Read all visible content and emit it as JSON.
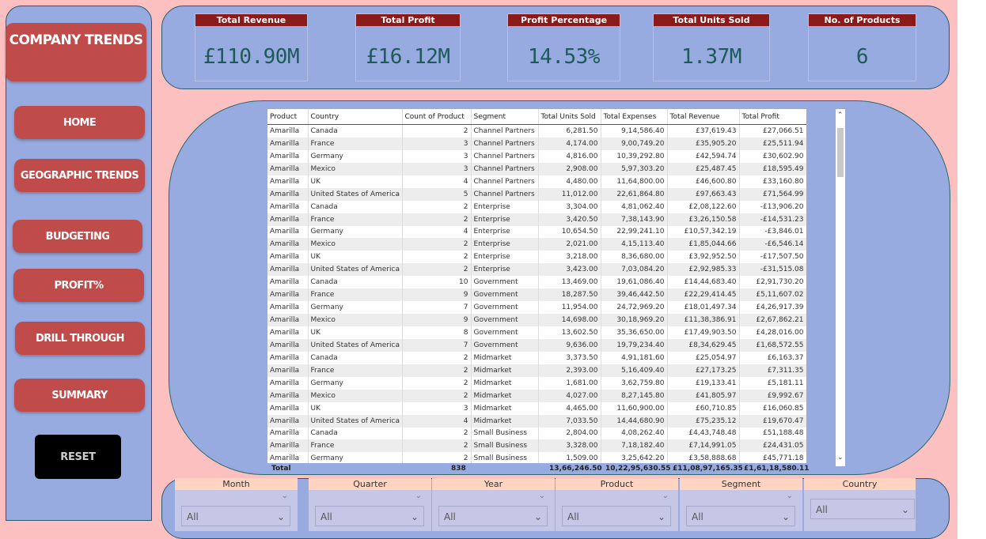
{
  "sidebar": {
    "logo": "COMPANY TRENDS",
    "nav": [
      "HOME",
      "GEOGRAPHIC TRENDS",
      "BUDGETING",
      "PROFIT%",
      "DRILL THROUGH",
      "SUMMARY"
    ],
    "reset": "RESET"
  },
  "kpis": [
    {
      "title": "Total Revenue",
      "value": "£110.90M"
    },
    {
      "title": "Total Profit",
      "value": "£16.12M"
    },
    {
      "title": "Profit Percentage",
      "value": "14.53%"
    },
    {
      "title": "Total Units Sold",
      "value": "1.37M"
    },
    {
      "title": "No. of Products",
      "value": "6"
    }
  ],
  "table": {
    "headers": [
      "Product",
      "Country",
      "Count of Product",
      "Segment",
      "Total Units Sold",
      "Total Expenses",
      "Total Revenue",
      "Total Profit"
    ],
    "rows": [
      [
        "Amarilla",
        "Canada",
        "2",
        "Channel Partners",
        "6,281.50",
        "9,14,586.40",
        "£37,619.43",
        "£27,066.51"
      ],
      [
        "Amarilla",
        "France",
        "3",
        "Channel Partners",
        "4,174.00",
        "9,00,749.20",
        "£35,905.20",
        "£25,511.94"
      ],
      [
        "Amarilla",
        "Germany",
        "3",
        "Channel Partners",
        "4,816.00",
        "10,39,292.80",
        "£42,594.74",
        "£30,602.90"
      ],
      [
        "Amarilla",
        "Mexico",
        "3",
        "Channel Partners",
        "2,908.00",
        "5,97,303.20",
        "£25,487.45",
        "£18,595.49"
      ],
      [
        "Amarilla",
        "UK",
        "4",
        "Channel Partners",
        "4,480.00",
        "11,64,800.00",
        "£46,600.80",
        "£33,160.80"
      ],
      [
        "Amarilla",
        "United States of America",
        "5",
        "Channel Partners",
        "11,012.00",
        "22,61,864.80",
        "£97,663.43",
        "£71,564.99"
      ],
      [
        "Amarilla",
        "Canada",
        "2",
        "Enterprise",
        "3,304.00",
        "4,81,062.40",
        "£2,08,122.60",
        "-£13,906.20"
      ],
      [
        "Amarilla",
        "France",
        "2",
        "Enterprise",
        "3,420.50",
        "7,38,143.90",
        "£3,26,150.58",
        "-£14,531.23"
      ],
      [
        "Amarilla",
        "Germany",
        "4",
        "Enterprise",
        "10,654.50",
        "22,99,241.10",
        "£10,57,342.19",
        "-£3,846.01"
      ],
      [
        "Amarilla",
        "Mexico",
        "2",
        "Enterprise",
        "2,021.00",
        "4,15,113.40",
        "£1,85,044.66",
        "-£6,546.14"
      ],
      [
        "Amarilla",
        "UK",
        "2",
        "Enterprise",
        "3,218.00",
        "8,36,680.00",
        "£3,92,952.50",
        "-£17,507.50"
      ],
      [
        "Amarilla",
        "United States of America",
        "2",
        "Enterprise",
        "3,423.00",
        "7,03,084.20",
        "£2,92,985.33",
        "-£31,515.08"
      ],
      [
        "Amarilla",
        "Canada",
        "10",
        "Government",
        "13,469.00",
        "19,61,086.40",
        "£14,44,683.40",
        "£2,91,730.20"
      ],
      [
        "Amarilla",
        "France",
        "9",
        "Government",
        "18,287.50",
        "39,46,442.50",
        "£22,29,414.45",
        "£5,11,607.02"
      ],
      [
        "Amarilla",
        "Germany",
        "7",
        "Government",
        "11,954.00",
        "24,72,969.20",
        "£18,01,497.34",
        "£4,26,917.39"
      ],
      [
        "Amarilla",
        "Mexico",
        "9",
        "Government",
        "14,698.00",
        "30,18,969.20",
        "£11,38,386.91",
        "£2,67,862.21"
      ],
      [
        "Amarilla",
        "UK",
        "8",
        "Government",
        "13,602.50",
        "35,36,650.00",
        "£17,49,903.50",
        "£4,28,016.00"
      ],
      [
        "Amarilla",
        "United States of America",
        "7",
        "Government",
        "9,636.00",
        "19,79,234.40",
        "£8,34,629.45",
        "£1,68,572.55"
      ],
      [
        "Amarilla",
        "Canada",
        "2",
        "Midmarket",
        "3,373.50",
        "4,91,181.60",
        "£25,054.97",
        "£6,163.37"
      ],
      [
        "Amarilla",
        "France",
        "2",
        "Midmarket",
        "2,393.00",
        "5,16,409.40",
        "£27,173.25",
        "£7,311.35"
      ],
      [
        "Amarilla",
        "Germany",
        "2",
        "Midmarket",
        "1,681.00",
        "3,62,759.80",
        "£19,133.41",
        "£5,181.11"
      ],
      [
        "Amarilla",
        "Mexico",
        "2",
        "Midmarket",
        "4,027.00",
        "8,27,145.80",
        "£41,805.97",
        "£9,992.67"
      ],
      [
        "Amarilla",
        "UK",
        "3",
        "Midmarket",
        "4,465.00",
        "11,60,900.00",
        "£60,710.85",
        "£16,060.85"
      ],
      [
        "Amarilla",
        "United States of America",
        "4",
        "Midmarket",
        "7,033.50",
        "14,44,680.90",
        "£75,235.12",
        "£19,670.47"
      ],
      [
        "Amarilla",
        "Canada",
        "2",
        "Small Business",
        "2,804.00",
        "4,08,262.40",
        "£4,43,748.48",
        "£51,188.48"
      ],
      [
        "Amarilla",
        "France",
        "2",
        "Small Business",
        "3,328.00",
        "7,18,182.40",
        "£7,14,991.05",
        "£24,431.05"
      ],
      [
        "Amarilla",
        "Germany",
        "2",
        "Small Business",
        "1,509.00",
        "3,25,642.20",
        "£3,58,888.68",
        "£45,771.18"
      ]
    ],
    "total": {
      "label": "Total",
      "count": "838",
      "units": "13,66,246.50",
      "expenses": "10,22,95,630.55",
      "revenue": "£11,08,97,165.35",
      "profit": "£1,61,18,580.11"
    }
  },
  "slicers": [
    {
      "label": "Month",
      "value": "All"
    },
    {
      "label": "Quarter",
      "value": "All"
    },
    {
      "label": "Year",
      "value": "All"
    },
    {
      "label": "Product",
      "value": "All"
    },
    {
      "label": "Segment",
      "value": "All"
    },
    {
      "label": "Country",
      "value": "All"
    }
  ],
  "colors": {
    "background": "#fcc0c0",
    "panel": "#97abe0",
    "button": "#bf4b4b",
    "kpi_title": "#8b1a1a",
    "kpi_value": "#1d5a5a",
    "slicer_head": "#ffd4c0"
  }
}
